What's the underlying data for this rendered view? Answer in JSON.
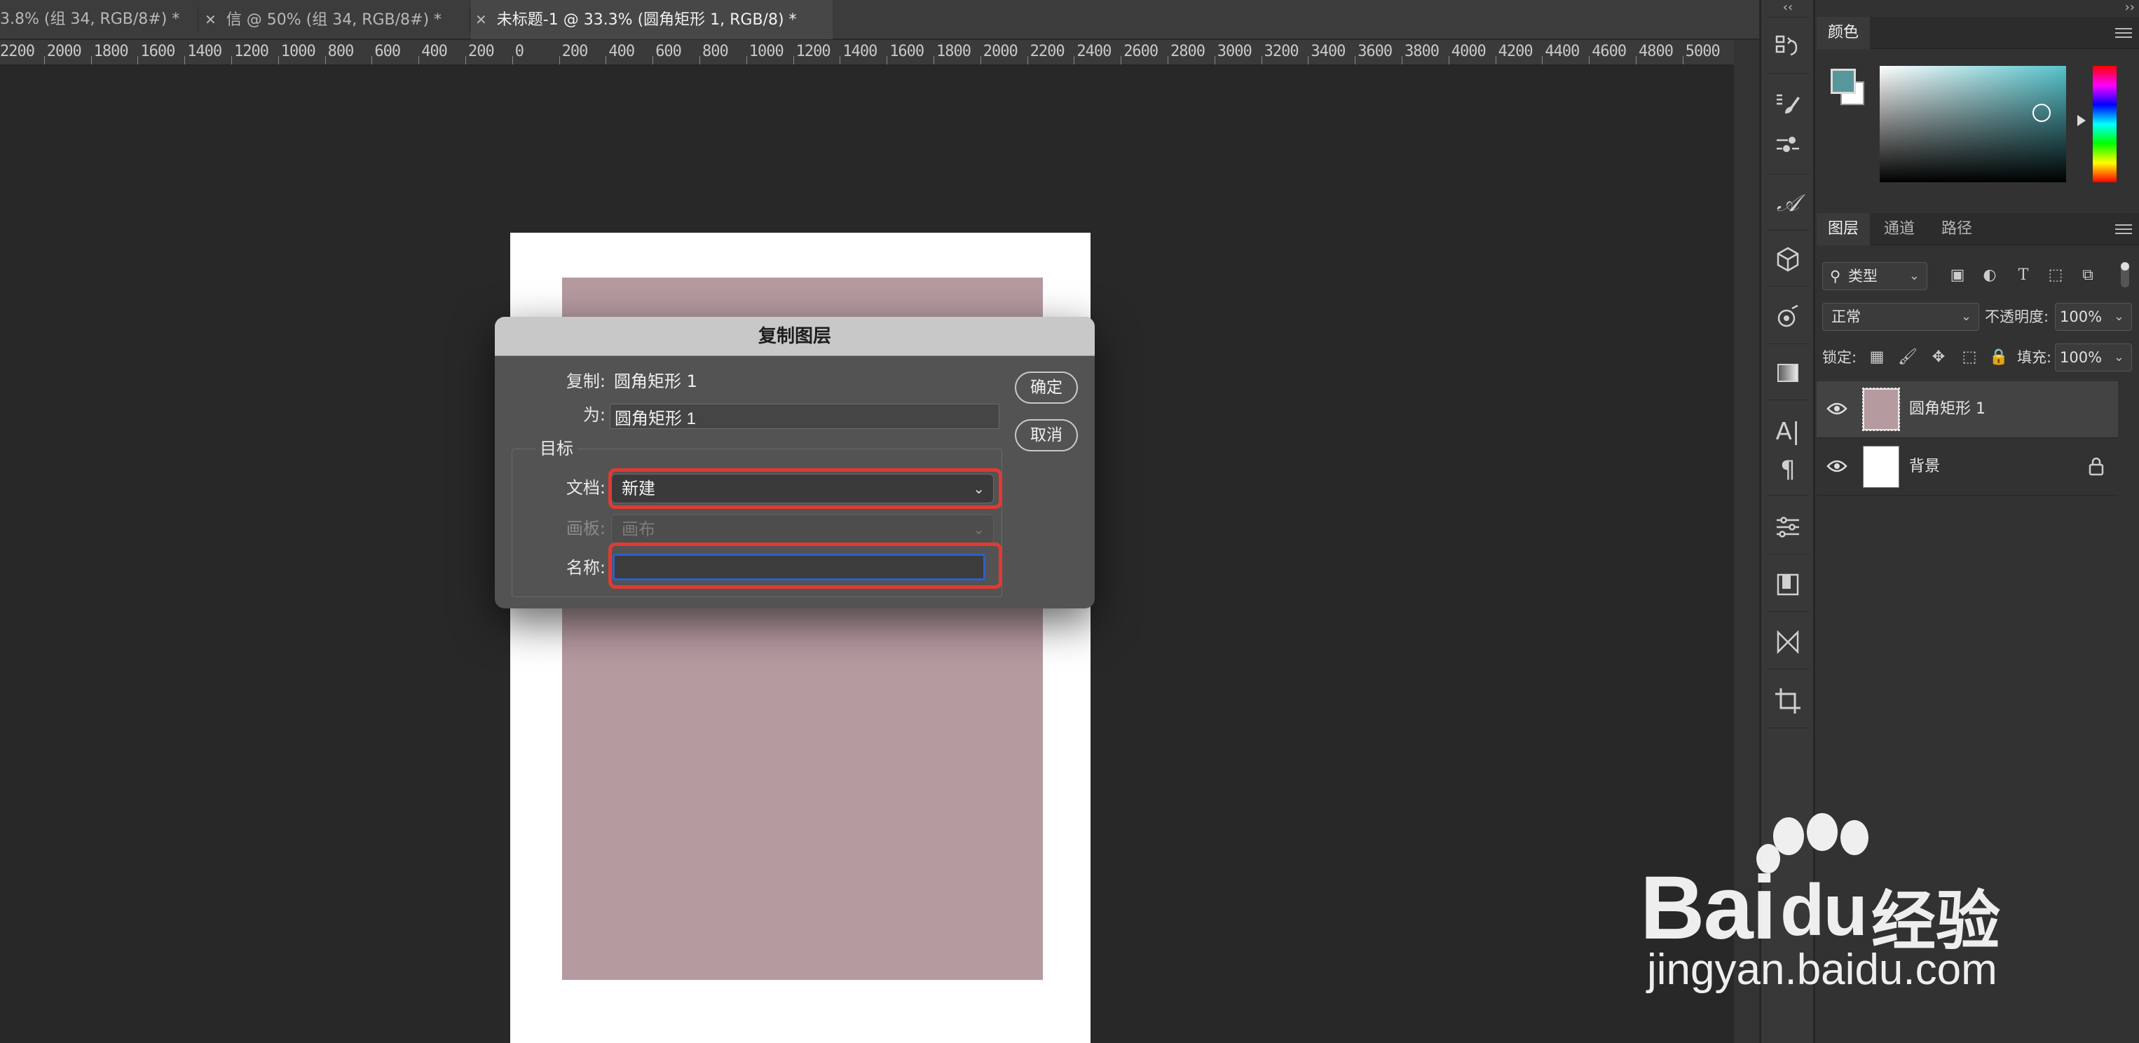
{
  "tabs": [
    {
      "label": "3.8% (组 34, RGB/8#) *",
      "active": false
    },
    {
      "label": "信 @ 50% (组 34, RGB/8#) *",
      "active": false
    },
    {
      "label": "未标题-1 @ 33.3% (圆角矩形 1, RGB/8) *",
      "active": true
    }
  ],
  "ruler_labels": [
    "2200",
    "2000",
    "1800",
    "1600",
    "1400",
    "1200",
    "1000",
    "800",
    "600",
    "400",
    "200",
    "0",
    "200",
    "400",
    "600",
    "800",
    "1000",
    "1200",
    "1400",
    "1600",
    "1800",
    "2000",
    "2200",
    "2400",
    "2600",
    "2800",
    "3000",
    "3200",
    "3400",
    "3600",
    "3800",
    "4000",
    "4200",
    "4400",
    "4600",
    "4800",
    "5000"
  ],
  "toolbar": {
    "collapse": "‹‹"
  },
  "right_panel_collapse": "››",
  "color_panel": {
    "tab": "颜色",
    "fg_color": "#56979c",
    "bg_color": "#ffffff"
  },
  "layers_panel": {
    "tabs": [
      "图层",
      "通道",
      "路径"
    ],
    "filter_label": "类型",
    "blend_mode": "正常",
    "opacity_label": "不透明度:",
    "opacity_value": "100%",
    "lock_label": "锁定:",
    "fill_label": "填充:",
    "fill_value": "100%",
    "layers": [
      {
        "name": "圆角矩形 1",
        "selected": true
      },
      {
        "name": "背景",
        "selected": false,
        "locked": true
      }
    ]
  },
  "dialog": {
    "title": "复制图层",
    "copy_label": "复制:",
    "copy_value": "圆角矩形 1",
    "as_label": "为:",
    "as_value": "圆角矩形 1",
    "group_title": "目标",
    "document_label": "文档:",
    "document_value": "新建",
    "artboard_label": "画板:",
    "artboard_value": "画布",
    "name_label": "名称:",
    "name_value": "",
    "ok_label": "确定",
    "cancel_label": "取消"
  },
  "canvas": {
    "shape_color": "#b59a9f"
  },
  "watermark": {
    "brand": "Bai",
    "brand_tail": "du",
    "brand_cn": "经验",
    "url": "jingyan.baidu.com"
  }
}
